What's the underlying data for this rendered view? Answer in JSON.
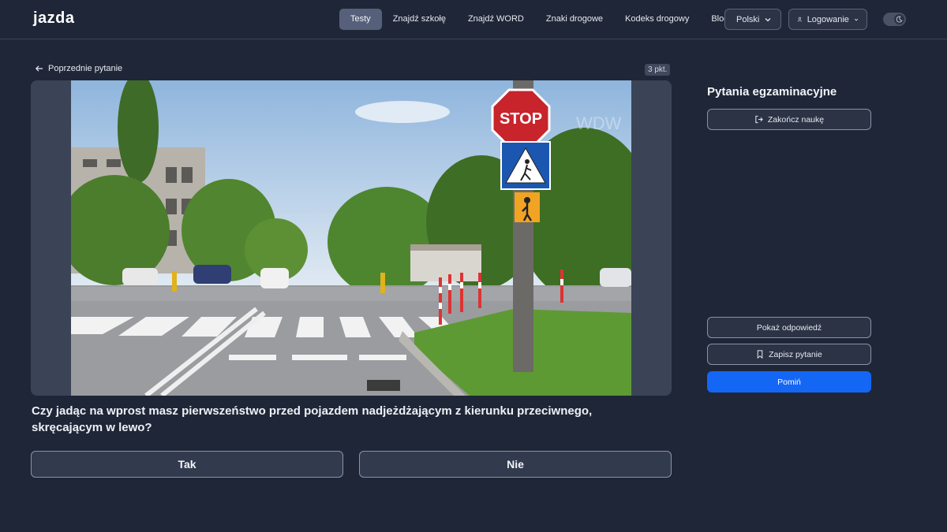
{
  "header": {
    "logo": "jazda",
    "nav": [
      {
        "label": "Testy",
        "active": true
      },
      {
        "label": "Znajdź szkołę",
        "active": false
      },
      {
        "label": "Znajdź WORD",
        "active": false
      },
      {
        "label": "Znaki drogowe",
        "active": false
      },
      {
        "label": "Kodeks drogowy",
        "active": false
      },
      {
        "label": "Blog",
        "active": false
      }
    ],
    "language": "Polski",
    "login": "Logowanie",
    "theme_icon": "moon-icon"
  },
  "main": {
    "back_label": "Poprzednie pytanie",
    "points": "3 pkt.",
    "image": {
      "description_icon": "exam-photo",
      "sign_text": "STOP",
      "watermark": "WDW"
    },
    "question": "Czy jadąc na wprost masz pierwszeństwo przed pojazdem nadjeżdżającym z kierunku przeciwnego, skręcającym w lewo?",
    "answers": {
      "yes": "Tak",
      "no": "Nie"
    }
  },
  "sidebar": {
    "title": "Pytania egzaminacyjne",
    "finish_label": "Zakończ naukę",
    "show_answer_label": "Pokaż odpowiedź",
    "save_label": "Zapisz pytanie",
    "skip_label": "Pomiń"
  },
  "colors": {
    "background": "#1f2637",
    "accent": "#1466f5",
    "active_nav": "#56607a"
  }
}
